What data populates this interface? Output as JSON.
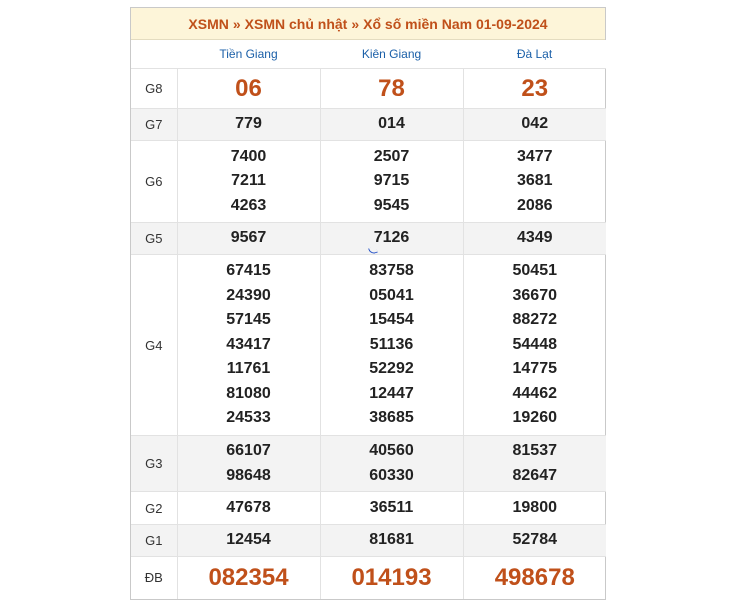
{
  "breadcrumb": {
    "items": [
      "XSMN",
      "XSMN chủ nhật",
      "Xổ số miền Nam 01-09-2024"
    ],
    "separator": "»"
  },
  "provinces": [
    "Tiền Giang",
    "Kiên Giang",
    "Đà Lạt"
  ],
  "prizes": {
    "g8": {
      "label": "G8",
      "values": [
        "06",
        "78",
        "23"
      ]
    },
    "g7": {
      "label": "G7",
      "values": [
        "779",
        "014",
        "042"
      ]
    },
    "g6": {
      "label": "G6",
      "values": [
        [
          "7400",
          "7211",
          "4263"
        ],
        [
          "2507",
          "9715",
          "9545"
        ],
        [
          "3477",
          "3681",
          "2086"
        ]
      ]
    },
    "g5": {
      "label": "G5",
      "values": [
        "9567",
        "7126",
        "4349"
      ]
    },
    "g4": {
      "label": "G4",
      "values": [
        [
          "67415",
          "24390",
          "57145",
          "43417",
          "11761",
          "81080",
          "24533"
        ],
        [
          "83758",
          "05041",
          "15454",
          "51136",
          "52292",
          "12447",
          "38685"
        ],
        [
          "50451",
          "36670",
          "88272",
          "54448",
          "14775",
          "44462",
          "19260"
        ]
      ]
    },
    "g3": {
      "label": "G3",
      "values": [
        [
          "66107",
          "98648"
        ],
        [
          "40560",
          "60330"
        ],
        [
          "81537",
          "82647"
        ]
      ]
    },
    "g2": {
      "label": "G2",
      "values": [
        "47678",
        "36511",
        "19800"
      ]
    },
    "g1": {
      "label": "G1",
      "values": [
        "12454",
        "81681",
        "52784"
      ]
    },
    "db": {
      "label": "ĐB",
      "values": [
        "082354",
        "014193",
        "498678"
      ]
    }
  },
  "colors": {
    "accent": "#c0501a",
    "province_header": "#1a5fa8",
    "header_bg": "#fdf5d9",
    "row_shade": "#f3f3f3"
  }
}
